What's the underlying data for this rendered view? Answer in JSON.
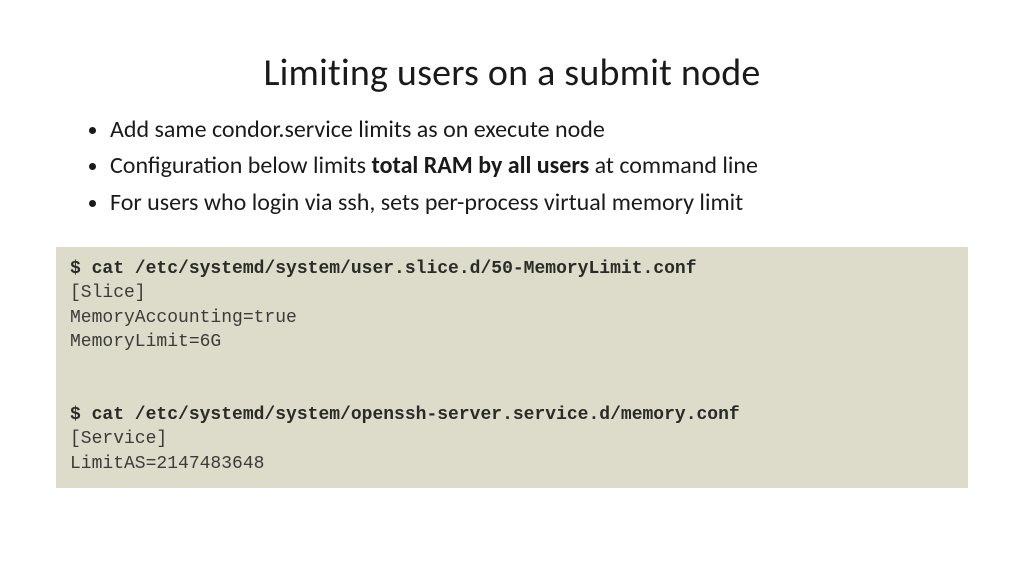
{
  "title": "Limiting users on a submit node",
  "bullets": {
    "b1": "Add same condor.service limits as on execute node",
    "b2_pre": "Configuration below limits ",
    "b2_bold": "total RAM by all users",
    "b2_post": " at command line",
    "b3": "For users who login via ssh, sets per-process virtual memory limit"
  },
  "code": {
    "cmd1": "$ cat /etc/systemd/system/user.slice.d/50-MemoryLimit.conf",
    "line1": "[Slice]",
    "line2": "MemoryAccounting=true",
    "line3": "MemoryLimit=6G",
    "blank": "",
    "cmd2": "$ cat /etc/systemd/system/openssh-server.service.d/memory.conf",
    "line4": "[Service]",
    "line5": "LimitAS=2147483648"
  }
}
